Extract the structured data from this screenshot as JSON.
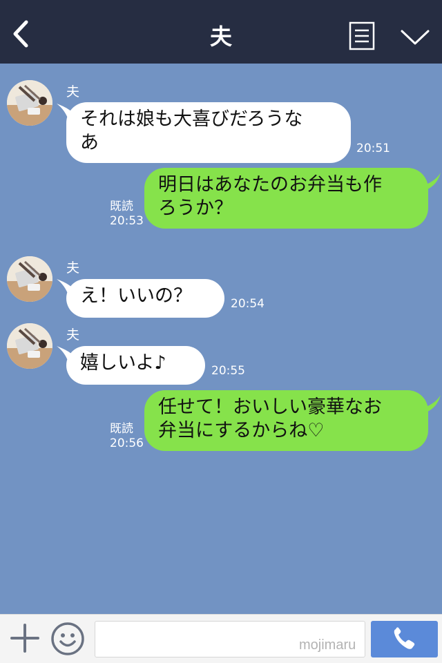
{
  "header": {
    "title": "夫",
    "back_icon": "chevron-left-icon",
    "menu_icon": "list-icon",
    "collapse_icon": "chevron-down-icon",
    "background": "#262d42"
  },
  "chat": {
    "background": "#7293c3",
    "messages": [
      {
        "side": "in",
        "sender": "夫",
        "lines": [
          "それは娘も大喜びだろうな",
          "あ"
        ],
        "time": "20:51"
      },
      {
        "side": "out",
        "read": "既読",
        "lines": [
          "明日はあなたのお弁当も作",
          "ろうか？"
        ],
        "time": "20:53"
      },
      {
        "side": "in",
        "sender": "夫",
        "lines": [
          "え！いいの？"
        ],
        "time": "20:54"
      },
      {
        "side": "in",
        "sender": "夫",
        "lines": [
          "嬉しいよ♪"
        ],
        "time": "20:55"
      },
      {
        "side": "out",
        "read": "既読",
        "lines": [
          "任せて！おいしい豪華なお",
          "弁当にするからね♡"
        ],
        "time": "20:56"
      }
    ]
  },
  "colors": {
    "incoming": "#ffffff",
    "outgoing": "#86e24b",
    "call_button": "#5b8ad9"
  },
  "footer": {
    "plus_icon": "plus-icon",
    "emoji_icon": "smiley-icon",
    "input_value": "",
    "watermark": "mojimaru",
    "call_icon": "phone-icon"
  }
}
